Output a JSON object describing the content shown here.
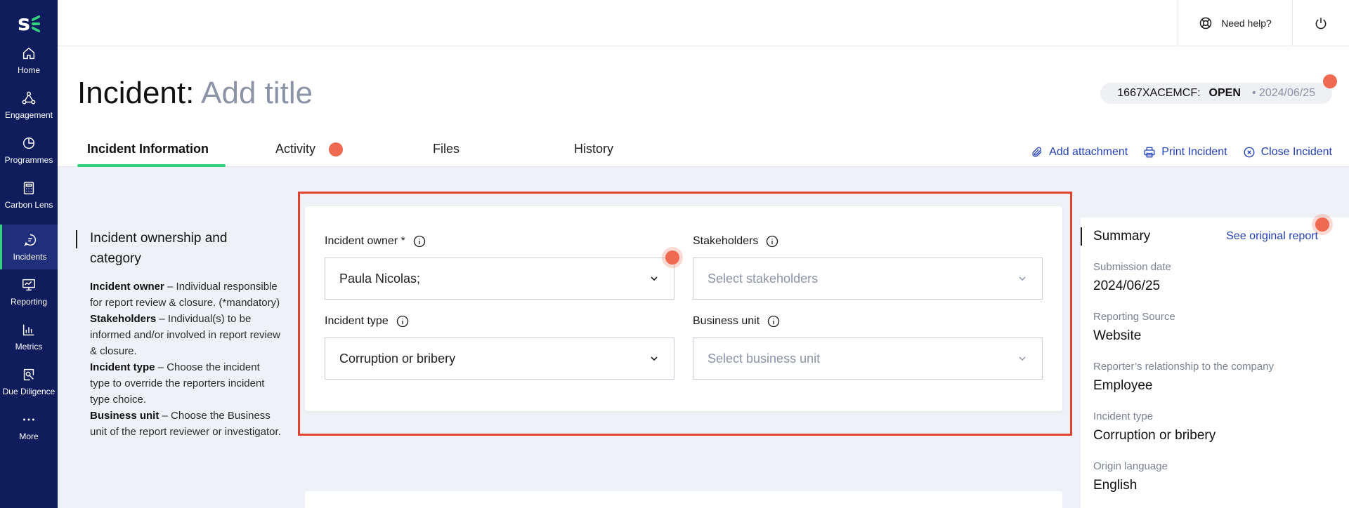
{
  "sidebar": {
    "items": [
      {
        "label": "Home",
        "icon": "home-icon"
      },
      {
        "label": "Engagement",
        "icon": "network-icon"
      },
      {
        "label": "Programmes",
        "icon": "pie-chart-icon"
      },
      {
        "label": "Carbon Lens",
        "icon": "calculator-icon"
      },
      {
        "label": "Incidents",
        "icon": "chat-bubble-icon"
      },
      {
        "label": "Reporting",
        "icon": "presentation-icon"
      },
      {
        "label": "Metrics",
        "icon": "bar-chart-icon"
      },
      {
        "label": "Due Diligence",
        "icon": "document-search-icon"
      },
      {
        "label": "More",
        "icon": "more-icon"
      }
    ],
    "active": "Incidents"
  },
  "topbar": {
    "help_label": "Need help?"
  },
  "header": {
    "title_prefix": "Incident:",
    "title_placeholder": "Add title",
    "ref": "1667XACEMCF:",
    "status": "OPEN",
    "date": "• 2024/06/25"
  },
  "tabs": [
    {
      "label": "Incident Information"
    },
    {
      "label": "Activity"
    },
    {
      "label": "Files"
    },
    {
      "label": "History"
    }
  ],
  "actions": {
    "add_attachment": "Add attachment",
    "print_incident": "Print Incident",
    "close_incident": "Close Incident"
  },
  "description": {
    "heading": "Incident ownership and category",
    "owner_term": "Incident owner",
    "owner_text": " – Individual responsible for report review & closure. (*mandatory)",
    "stakeholders_term": "Stakeholders",
    "stakeholders_text": " – Individual(s) to be informed and/or involved in report review & closure.",
    "type_term": "Incident type",
    "type_text": " – Choose the incident type to override the reporters incident type choice.",
    "unit_term": "Business unit",
    "unit_text": " – Choose the Business unit of the report reviewer or investigator."
  },
  "form": {
    "owner_label": "Incident owner *",
    "owner_value": "Paula Nicolas;",
    "stakeholders_label": "Stakeholders",
    "stakeholders_placeholder": "Select stakeholders",
    "type_label": "Incident type",
    "type_value": "Corruption or bribery",
    "unit_label": "Business unit",
    "unit_placeholder": "Select business unit"
  },
  "summary": {
    "title": "Summary",
    "link": "See original report",
    "items": [
      {
        "label": "Submission date",
        "value": "2024/06/25"
      },
      {
        "label": "Reporting Source",
        "value": "Website"
      },
      {
        "label": "Reporter’s relationship to the company",
        "value": "Employee"
      },
      {
        "label": "Incident type",
        "value": "Corruption or bribery"
      },
      {
        "label": "Origin language",
        "value": "English"
      }
    ]
  },
  "colors": {
    "sidebar_bg": "#0f1d5c",
    "accent_green": "#35d07f",
    "link_blue": "#2340b8",
    "highlight_red": "#e1432f",
    "marker_orange": "#ef6a50"
  }
}
